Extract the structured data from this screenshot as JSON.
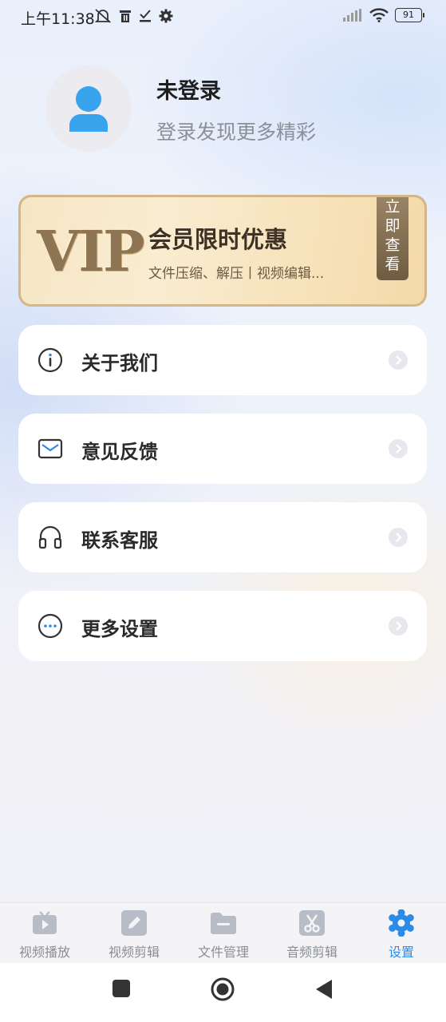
{
  "status_bar": {
    "time": "上午11:38",
    "battery": "91",
    "icons": [
      "mute-bell-icon",
      "trash-icon",
      "check-download-icon",
      "settings-gear-icon",
      "signal-icon",
      "wifi-icon",
      "battery-icon"
    ]
  },
  "profile": {
    "name": "未登录",
    "subtitle": "登录发现更多精彩"
  },
  "vip": {
    "logo": "VIP",
    "title": "会员限时优惠",
    "description": "文件压缩、解压丨视频编辑...",
    "action_chars": [
      "立",
      "即",
      "查",
      "看"
    ],
    "accent_color": "#d3b789"
  },
  "menu": [
    {
      "label": "关于我们",
      "icon": "info-icon"
    },
    {
      "label": "意见反馈",
      "icon": "mail-icon"
    },
    {
      "label": "联系客服",
      "icon": "headset-icon"
    },
    {
      "label": "更多设置",
      "icon": "more-icon"
    }
  ],
  "bottom_nav": [
    {
      "label": "视频播放",
      "icon": "tv-play-icon",
      "active": false
    },
    {
      "label": "视频剪辑",
      "icon": "pencil-edit-icon",
      "active": false
    },
    {
      "label": "文件管理",
      "icon": "folder-icon",
      "active": false
    },
    {
      "label": "音频剪辑",
      "icon": "scissors-icon",
      "active": false
    },
    {
      "label": "设置",
      "icon": "gear-icon",
      "active": true
    }
  ],
  "colors": {
    "active": "#2d8be8",
    "inactive": "#8a8d93"
  }
}
